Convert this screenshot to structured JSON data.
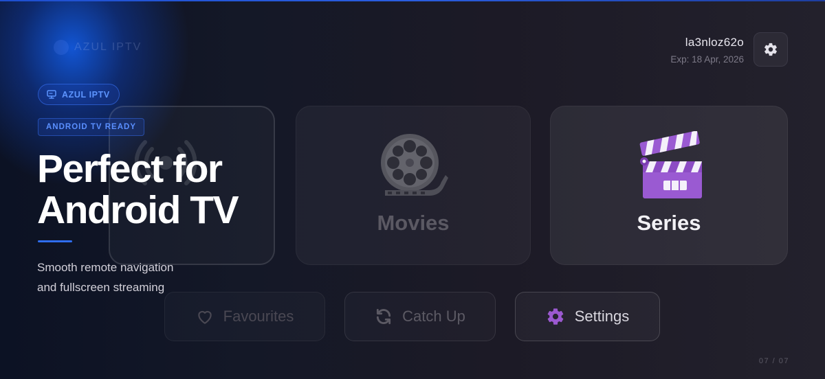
{
  "app": {
    "brand_faded": "AZUL IPTV"
  },
  "profile": {
    "username": "la3nloz62o",
    "expiry": "Exp: 18 Apr, 2026",
    "settings_icon": "gear-icon"
  },
  "tiles": {
    "live_icon": "broadcast-icon",
    "movies": {
      "label": "Movies",
      "icon": "film-reel-icon"
    },
    "series": {
      "label": "Series",
      "icon": "clapperboard-icon"
    }
  },
  "actions": {
    "favourites": {
      "label": "Favourites",
      "icon": "heart-icon"
    },
    "catch_up": {
      "label": "Catch Up",
      "icon": "refresh-icon"
    },
    "settings": {
      "label": "Settings",
      "icon": "gear-icon"
    }
  },
  "promo": {
    "brand_badge": "AZUL IPTV",
    "tag": "ANDROID TV READY",
    "headline_line1": "Perfect for",
    "headline_line2": "Android TV",
    "sub_line1": "Smooth remote navigation",
    "sub_line2": "and fullscreen streaming",
    "pager": "07 / 07"
  },
  "colors": {
    "accent_blue": "#2f6df0",
    "series_purple": "#9b59d0",
    "background": "#17161f"
  }
}
